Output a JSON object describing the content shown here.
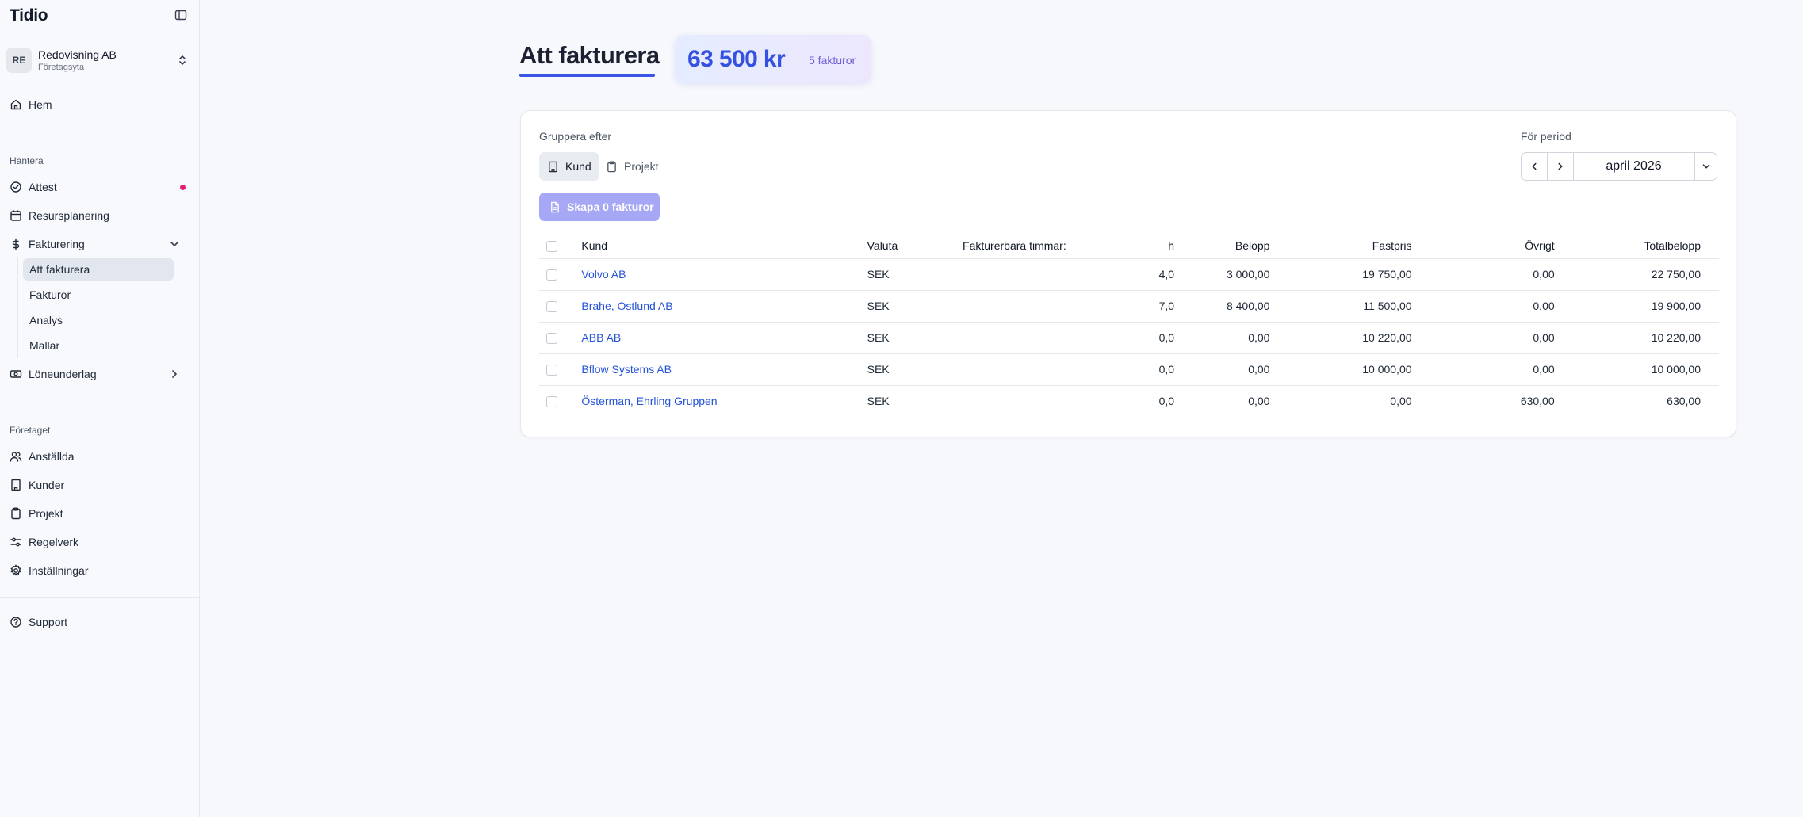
{
  "app": {
    "name": "Tidio"
  },
  "workspace": {
    "initials": "RE",
    "name": "Redovisning AB",
    "subtitle": "Företagsyta"
  },
  "sidebar": {
    "home": "Hem",
    "manage_label": "Hantera",
    "attest": "Attest",
    "resource_planning": "Resursplanering",
    "invoicing": "Fakturering",
    "invoicing_sub": [
      "Att fakturera",
      "Fakturor",
      "Analys",
      "Mallar"
    ],
    "payroll": "Löneunderlag",
    "company_label": "Företaget",
    "employees": "Anställda",
    "customers": "Kunder",
    "projects": "Projekt",
    "rules": "Regelverk",
    "settings": "Inställningar",
    "support": "Support"
  },
  "page": {
    "title": "Att fakturera",
    "summary_amount": "63 500 kr",
    "summary_count": "5 fakturor"
  },
  "controls": {
    "group_by_label": "Gruppera efter",
    "group_customer": "Kund",
    "group_project": "Projekt",
    "create_button": "Skapa 0 fakturor",
    "period_label": "För period",
    "period_value": "april 2026"
  },
  "table": {
    "headers": {
      "customer": "Kund",
      "currency": "Valuta",
      "billable_hours": "Fakturerbara timmar:",
      "hours": "h",
      "amount": "Belopp",
      "fixed_price": "Fastpris",
      "other": "Övrigt",
      "total": "Totalbelopp"
    },
    "rows": [
      {
        "customer": "Volvo AB",
        "currency": "SEK",
        "hours": "4,0",
        "amount": "3 000,00",
        "fixed_price": "19 750,00",
        "other": "0,00",
        "total": "22 750,00"
      },
      {
        "customer": "Brahe, Ostlund AB",
        "currency": "SEK",
        "hours": "7,0",
        "amount": "8 400,00",
        "fixed_price": "11 500,00",
        "other": "0,00",
        "total": "19 900,00"
      },
      {
        "customer": "ABB AB",
        "currency": "SEK",
        "hours": "0,0",
        "amount": "0,00",
        "fixed_price": "10 220,00",
        "other": "0,00",
        "total": "10 220,00"
      },
      {
        "customer": "Bflow Systems AB",
        "currency": "SEK",
        "hours": "0,0",
        "amount": "0,00",
        "fixed_price": "10 000,00",
        "other": "0,00",
        "total": "10 000,00"
      },
      {
        "customer": "Österman, Ehrling Gruppen",
        "currency": "SEK",
        "hours": "0,0",
        "amount": "0,00",
        "fixed_price": "0,00",
        "other": "630,00",
        "total": "630,00"
      }
    ]
  },
  "colors": {
    "accent": "#3b55e6",
    "link": "#2453d8",
    "notification": "#e11d74",
    "create_button": "#a6a8f5"
  }
}
